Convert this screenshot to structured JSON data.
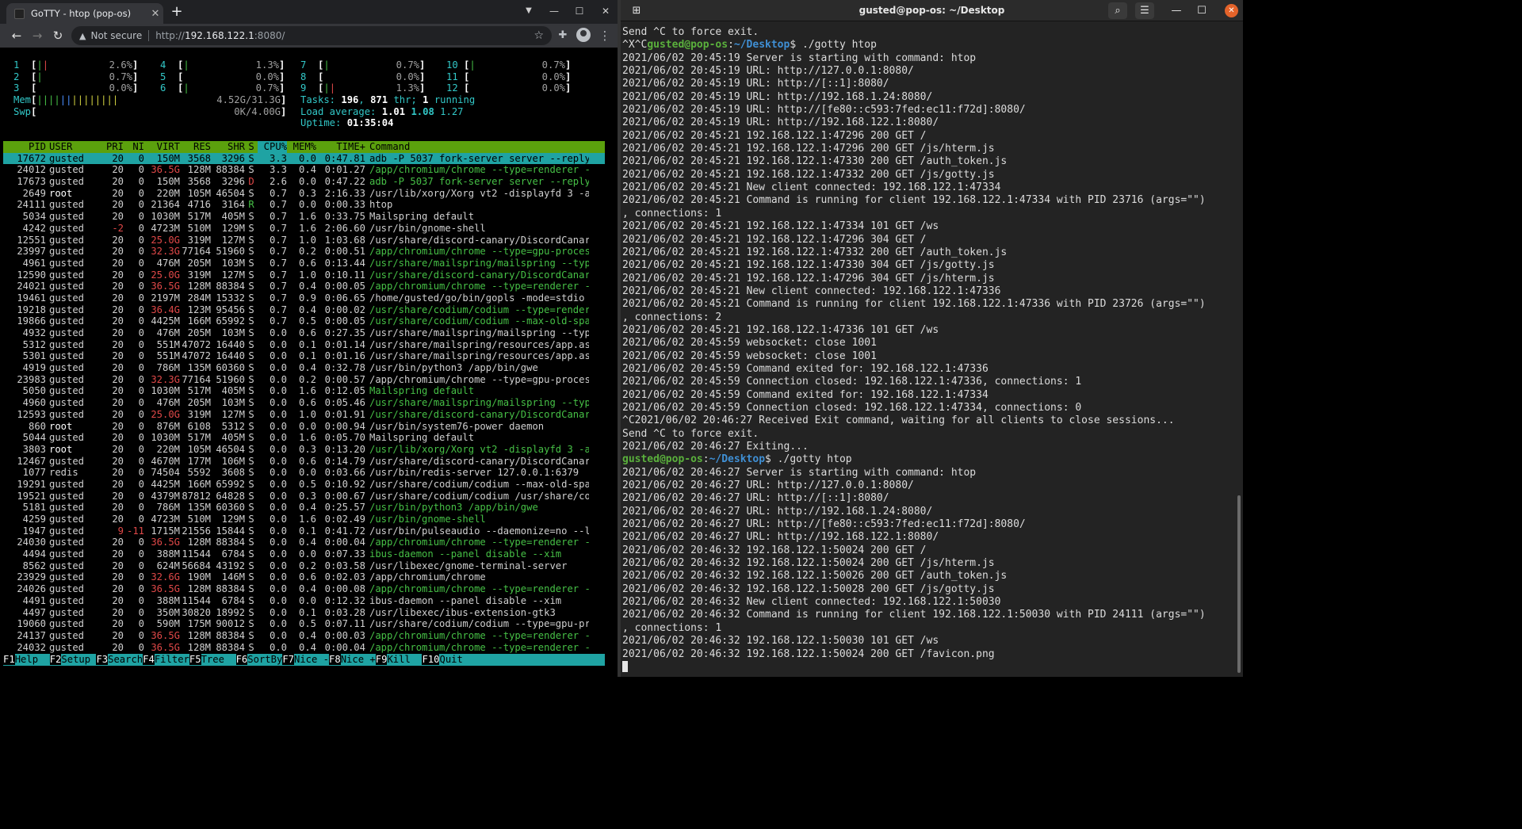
{
  "browser": {
    "tab_title": "GoTTY - htop (pop-os)",
    "tab_close": "✕",
    "new_tab": "+",
    "not_secure": "Not secure",
    "url_proto": "http://",
    "url_host": "192.168.122.1",
    "url_path": ":8080/"
  },
  "htop": {
    "cpu_meters": [
      {
        "num": "1",
        "bar": "||",
        "val": "2.6%"
      },
      {
        "num": "2",
        "bar": "|",
        "val": "0.7%"
      },
      {
        "num": "3",
        "bar": "",
        "val": "0.0%"
      },
      {
        "num": "4",
        "bar": "|",
        "val": "1.3%"
      },
      {
        "num": "5",
        "bar": "",
        "val": "0.0%"
      },
      {
        "num": "6",
        "bar": "|",
        "val": "0.7%"
      },
      {
        "num": "7",
        "bar": "|",
        "val": "0.7%"
      },
      {
        "num": "8",
        "bar": "",
        "val": "0.0%"
      },
      {
        "num": "9",
        "bar": "||",
        "val": "1.3%"
      },
      {
        "num": "10",
        "bar": "|",
        "val": "0.7%"
      },
      {
        "num": "11",
        "bar": "",
        "val": "0.0%"
      },
      {
        "num": "12",
        "bar": "",
        "val": "0.0%"
      }
    ],
    "mem": {
      "label": "Mem",
      "bar": "||||||||||||||",
      "val": "4.52G/31.3G"
    },
    "swp": {
      "label": "Swp",
      "bar": "",
      "val": "0K/4.00G"
    },
    "tasks": {
      "label": "Tasks:",
      "count": "196",
      "thr": "871",
      "thr_label": "thr;",
      "running": "1",
      "running_label": "running"
    },
    "load": {
      "label": "Load average:",
      "v1": "1.01",
      "v2": "1.08",
      "v3": "1.27"
    },
    "uptime": {
      "label": "Uptime:",
      "val": "01:35:04"
    },
    "columns": [
      "PID",
      "USER",
      "PRI",
      "NI",
      "VIRT",
      "RES",
      "SHR",
      "S",
      "CPU%",
      "MEM%",
      "TIME+",
      "Command"
    ],
    "processes": [
      [
        "17672",
        "gusted",
        "20",
        "0",
        "150M",
        "3568",
        "3296",
        "S",
        "3.3",
        "0.0",
        "0:47.81",
        "adb -P 5037 fork-server server --reply"
      ],
      [
        "24012",
        "gusted",
        "20",
        "0",
        "36.5G",
        "128M",
        "88384",
        "S",
        "3.3",
        "0.4",
        "0:01.27",
        "/app/chromium/chrome --type=renderer -"
      ],
      [
        "17673",
        "gusted",
        "20",
        "0",
        "150M",
        "3568",
        "3296",
        "D",
        "2.6",
        "0.0",
        "0:47.22",
        "adb -P 5037 fork-server server --reply"
      ],
      [
        "2649",
        "root",
        "20",
        "0",
        "220M",
        "105M",
        "46504",
        "S",
        "0.7",
        "0.3",
        "2:16.33",
        "/usr/lib/xorg/Xorg vt2 -displayfd 3 -a"
      ],
      [
        "24111",
        "gusted",
        "20",
        "0",
        "21364",
        "4716",
        "3164",
        "R",
        "0.7",
        "0.0",
        "0:00.33",
        "htop"
      ],
      [
        "5034",
        "gusted",
        "20",
        "0",
        "1030M",
        "517M",
        "405M",
        "S",
        "0.7",
        "1.6",
        "0:33.75",
        "Mailspring default"
      ],
      [
        "4242",
        "gusted",
        "-2",
        "0",
        "4723M",
        "510M",
        "129M",
        "S",
        "0.7",
        "1.6",
        "2:06.60",
        "/usr/bin/gnome-shell"
      ],
      [
        "12551",
        "gusted",
        "20",
        "0",
        "25.0G",
        "319M",
        "127M",
        "S",
        "0.7",
        "1.0",
        "1:03.68",
        "/usr/share/discord-canary/DiscordCanar"
      ],
      [
        "23997",
        "gusted",
        "20",
        "0",
        "32.3G",
        "77164",
        "51960",
        "S",
        "0.7",
        "0.2",
        "0:00.51",
        "/app/chromium/chrome --type=gpu-proces"
      ],
      [
        "4961",
        "gusted",
        "20",
        "0",
        "476M",
        "205M",
        "103M",
        "S",
        "0.7",
        "0.6",
        "0:13.44",
        "/usr/share/mailspring/mailspring --typ"
      ],
      [
        "12590",
        "gusted",
        "20",
        "0",
        "25.0G",
        "319M",
        "127M",
        "S",
        "0.7",
        "1.0",
        "0:10.11",
        "/usr/share/discord-canary/DiscordCanar"
      ],
      [
        "24021",
        "gusted",
        "20",
        "0",
        "36.5G",
        "128M",
        "88384",
        "S",
        "0.7",
        "0.4",
        "0:00.05",
        "/app/chromium/chrome --type=renderer -"
      ],
      [
        "19461",
        "gusted",
        "20",
        "0",
        "2197M",
        "284M",
        "15332",
        "S",
        "0.7",
        "0.9",
        "0:06.65",
        "/home/gusted/go/bin/gopls -mode=stdio"
      ],
      [
        "19218",
        "gusted",
        "20",
        "0",
        "36.4G",
        "123M",
        "95456",
        "S",
        "0.7",
        "0.4",
        "0:00.02",
        "/usr/share/codium/codium --type=render"
      ],
      [
        "19866",
        "gusted",
        "20",
        "0",
        "4425M",
        "166M",
        "65992",
        "S",
        "0.7",
        "0.5",
        "0:00.05",
        "/usr/share/codium/codium --max-old-spa"
      ],
      [
        "4932",
        "gusted",
        "20",
        "0",
        "476M",
        "205M",
        "103M",
        "S",
        "0.0",
        "0.6",
        "0:27.35",
        "/usr/share/mailspring/mailspring --typ"
      ],
      [
        "5312",
        "gusted",
        "20",
        "0",
        "551M",
        "47072",
        "16440",
        "S",
        "0.0",
        "0.1",
        "0:01.14",
        "/usr/share/mailspring/resources/app.as"
      ],
      [
        "5301",
        "gusted",
        "20",
        "0",
        "551M",
        "47072",
        "16440",
        "S",
        "0.0",
        "0.1",
        "0:01.16",
        "/usr/share/mailspring/resources/app.as"
      ],
      [
        "4919",
        "gusted",
        "20",
        "0",
        "786M",
        "135M",
        "60360",
        "S",
        "0.0",
        "0.4",
        "0:32.78",
        "/usr/bin/python3 /app/bin/gwe"
      ],
      [
        "23983",
        "gusted",
        "20",
        "0",
        "32.3G",
        "77164",
        "51960",
        "S",
        "0.0",
        "0.2",
        "0:00.57",
        "/app/chromium/chrome --type=gpu-proces"
      ],
      [
        "5050",
        "gusted",
        "20",
        "0",
        "1030M",
        "517M",
        "405M",
        "S",
        "0.0",
        "1.6",
        "0:12.05",
        "Mailspring default"
      ],
      [
        "4960",
        "gusted",
        "20",
        "0",
        "476M",
        "205M",
        "103M",
        "S",
        "0.0",
        "0.6",
        "0:05.46",
        "/usr/share/mailspring/mailspring --typ"
      ],
      [
        "12593",
        "gusted",
        "20",
        "0",
        "25.0G",
        "319M",
        "127M",
        "S",
        "0.0",
        "1.0",
        "0:01.91",
        "/usr/share/discord-canary/DiscordCanar"
      ],
      [
        "860",
        "root",
        "20",
        "0",
        "876M",
        "6108",
        "5312",
        "S",
        "0.0",
        "0.0",
        "0:00.94",
        "/usr/bin/system76-power daemon"
      ],
      [
        "5044",
        "gusted",
        "20",
        "0",
        "1030M",
        "517M",
        "405M",
        "S",
        "0.0",
        "1.6",
        "0:05.70",
        "Mailspring default"
      ],
      [
        "3803",
        "root",
        "20",
        "0",
        "220M",
        "105M",
        "46504",
        "S",
        "0.0",
        "0.3",
        "0:13.20",
        "/usr/lib/xorg/Xorg vt2 -displayfd 3 -a"
      ],
      [
        "12467",
        "gusted",
        "20",
        "0",
        "4670M",
        "177M",
        "106M",
        "S",
        "0.0",
        "0.6",
        "0:14.79",
        "/usr/share/discord-canary/DiscordCanar"
      ],
      [
        "1077",
        "redis",
        "20",
        "0",
        "74504",
        "5592",
        "3608",
        "S",
        "0.0",
        "0.0",
        "0:03.66",
        "/usr/bin/redis-server 127.0.0.1:6379"
      ],
      [
        "19291",
        "gusted",
        "20",
        "0",
        "4425M",
        "166M",
        "65992",
        "S",
        "0.0",
        "0.5",
        "0:10.92",
        "/usr/share/codium/codium --max-old-spa"
      ],
      [
        "19521",
        "gusted",
        "20",
        "0",
        "4379M",
        "87812",
        "64828",
        "S",
        "0.0",
        "0.3",
        "0:00.67",
        "/usr/share/codium/codium /usr/share/co"
      ],
      [
        "5181",
        "gusted",
        "20",
        "0",
        "786M",
        "135M",
        "60360",
        "S",
        "0.0",
        "0.4",
        "0:25.57",
        "/usr/bin/python3 /app/bin/gwe"
      ],
      [
        "4259",
        "gusted",
        "20",
        "0",
        "4723M",
        "510M",
        "129M",
        "S",
        "0.0",
        "1.6",
        "0:02.49",
        "/usr/bin/gnome-shell"
      ],
      [
        "1947",
        "gusted",
        "9",
        "-11",
        "1715M",
        "21556",
        "15844",
        "S",
        "0.0",
        "0.1",
        "0:41.72",
        "/usr/bin/pulseaudio --daemonize=no --l"
      ],
      [
        "24030",
        "gusted",
        "20",
        "0",
        "36.5G",
        "128M",
        "88384",
        "S",
        "0.0",
        "0.4",
        "0:00.04",
        "/app/chromium/chrome --type=renderer -"
      ],
      [
        "4494",
        "gusted",
        "20",
        "0",
        "388M",
        "11544",
        "6784",
        "S",
        "0.0",
        "0.0",
        "0:07.33",
        "ibus-daemon --panel disable --xim"
      ],
      [
        "8562",
        "gusted",
        "20",
        "0",
        "624M",
        "56684",
        "43192",
        "S",
        "0.0",
        "0.2",
        "0:03.58",
        "/usr/libexec/gnome-terminal-server"
      ],
      [
        "23929",
        "gusted",
        "20",
        "0",
        "32.6G",
        "190M",
        "146M",
        "S",
        "0.0",
        "0.6",
        "0:02.03",
        "/app/chromium/chrome"
      ],
      [
        "24026",
        "gusted",
        "20",
        "0",
        "36.5G",
        "128M",
        "88384",
        "S",
        "0.0",
        "0.4",
        "0:00.08",
        "/app/chromium/chrome --type=renderer -"
      ],
      [
        "4491",
        "gusted",
        "20",
        "0",
        "388M",
        "11544",
        "6784",
        "S",
        "0.0",
        "0.0",
        "0:12.32",
        "ibus-daemon --panel disable --xim"
      ],
      [
        "4497",
        "gusted",
        "20",
        "0",
        "350M",
        "30820",
        "18992",
        "S",
        "0.0",
        "0.1",
        "0:03.28",
        "/usr/libexec/ibus-extension-gtk3"
      ],
      [
        "19060",
        "gusted",
        "20",
        "0",
        "590M",
        "175M",
        "90012",
        "S",
        "0.0",
        "0.5",
        "0:07.11",
        "/usr/share/codium/codium --type=gpu-pr"
      ],
      [
        "24137",
        "gusted",
        "20",
        "0",
        "36.5G",
        "128M",
        "88384",
        "S",
        "0.0",
        "0.4",
        "0:00.03",
        "/app/chromium/chrome --type=renderer -"
      ],
      [
        "24032",
        "gusted",
        "20",
        "0",
        "36.5G",
        "128M",
        "88384",
        "S",
        "0.0",
        "0.4",
        "0:00.04",
        "/app/chromium/chrome --type=renderer -"
      ]
    ],
    "green_rows": [
      1,
      2,
      8,
      9,
      10,
      11,
      13,
      14,
      20,
      21,
      22,
      25,
      30,
      31,
      33,
      34,
      37,
      41,
      42
    ],
    "fkeys": [
      {
        "k": "F1",
        "l": "Help  "
      },
      {
        "k": "F2",
        "l": "Setup "
      },
      {
        "k": "F3",
        "l": "Search"
      },
      {
        "k": "F4",
        "l": "Filter"
      },
      {
        "k": "F5",
        "l": "Tree  "
      },
      {
        "k": "F6",
        "l": "SortBy"
      },
      {
        "k": "F7",
        "l": "Nice -"
      },
      {
        "k": "F8",
        "l": "Nice +"
      },
      {
        "k": "F9",
        "l": "Kill  "
      },
      {
        "k": "F10",
        "l": "Quit"
      }
    ]
  },
  "terminal": {
    "title": "gusted@pop-os: ~/Desktop",
    "prompt_user": "gusted@pop-os",
    "prompt_path": "~/Desktop",
    "lines": [
      {
        "t": "Send ^C to force exit."
      },
      {
        "pre": "^X^C",
        "prompt": true,
        "cmd": "$ ./gotty htop"
      },
      {
        "t": "2021/06/02 20:45:19 Server is starting with command: htop"
      },
      {
        "t": "2021/06/02 20:45:19 URL: http://127.0.0.1:8080/"
      },
      {
        "t": "2021/06/02 20:45:19 URL: http://[::1]:8080/"
      },
      {
        "t": "2021/06/02 20:45:19 URL: http://192.168.1.24:8080/"
      },
      {
        "t": "2021/06/02 20:45:19 URL: http://[fe80::c593:7fed:ec11:f72d]:8080/"
      },
      {
        "t": "2021/06/02 20:45:19 URL: http://192.168.122.1:8080/"
      },
      {
        "t": "2021/06/02 20:45:21 192.168.122.1:47296 200 GET /"
      },
      {
        "t": "2021/06/02 20:45:21 192.168.122.1:47296 200 GET /js/hterm.js"
      },
      {
        "t": "2021/06/02 20:45:21 192.168.122.1:47330 200 GET /auth_token.js"
      },
      {
        "t": "2021/06/02 20:45:21 192.168.122.1:47332 200 GET /js/gotty.js"
      },
      {
        "t": "2021/06/02 20:45:21 New client connected: 192.168.122.1:47334"
      },
      {
        "t": "2021/06/02 20:45:21 Command is running for client 192.168.122.1:47334 with PID 23716 (args=\"\")"
      },
      {
        "t": ", connections: 1"
      },
      {
        "t": "2021/06/02 20:45:21 192.168.122.1:47334 101 GET /ws"
      },
      {
        "t": "2021/06/02 20:45:21 192.168.122.1:47296 304 GET /"
      },
      {
        "t": "2021/06/02 20:45:21 192.168.122.1:47332 200 GET /auth_token.js"
      },
      {
        "t": "2021/06/02 20:45:21 192.168.122.1:47330 304 GET /js/gotty.js"
      },
      {
        "t": "2021/06/02 20:45:21 192.168.122.1:47296 304 GET /js/hterm.js"
      },
      {
        "t": "2021/06/02 20:45:21 New client connected: 192.168.122.1:47336"
      },
      {
        "t": "2021/06/02 20:45:21 Command is running for client 192.168.122.1:47336 with PID 23726 (args=\"\")"
      },
      {
        "t": ", connections: 2"
      },
      {
        "t": "2021/06/02 20:45:21 192.168.122.1:47336 101 GET /ws"
      },
      {
        "t": "2021/06/02 20:45:59 websocket: close 1001"
      },
      {
        "t": "2021/06/02 20:45:59 websocket: close 1001"
      },
      {
        "t": "2021/06/02 20:45:59 Command exited for: 192.168.122.1:47336"
      },
      {
        "t": "2021/06/02 20:45:59 Connection closed: 192.168.122.1:47336, connections: 1"
      },
      {
        "t": "2021/06/02 20:45:59 Command exited for: 192.168.122.1:47334"
      },
      {
        "t": "2021/06/02 20:45:59 Connection closed: 192.168.122.1:47334, connections: 0"
      },
      {
        "t": "^C2021/06/02 20:46:27 Received Exit command, waiting for all clients to close sessions..."
      },
      {
        "t": "Send ^C to force exit."
      },
      {
        "t": "2021/06/02 20:46:27 Exiting..."
      },
      {
        "pre": "",
        "prompt": true,
        "cmd": "$ ./gotty htop"
      },
      {
        "t": "2021/06/02 20:46:27 Server is starting with command: htop"
      },
      {
        "t": "2021/06/02 20:46:27 URL: http://127.0.0.1:8080/"
      },
      {
        "t": "2021/06/02 20:46:27 URL: http://[::1]:8080/"
      },
      {
        "t": "2021/06/02 20:46:27 URL: http://192.168.1.24:8080/"
      },
      {
        "t": "2021/06/02 20:46:27 URL: http://[fe80::c593:7fed:ec11:f72d]:8080/"
      },
      {
        "t": "2021/06/02 20:46:27 URL: http://192.168.122.1:8080/"
      },
      {
        "t": "2021/06/02 20:46:32 192.168.122.1:50024 200 GET /"
      },
      {
        "t": "2021/06/02 20:46:32 192.168.122.1:50024 200 GET /js/hterm.js"
      },
      {
        "t": "2021/06/02 20:46:32 192.168.122.1:50026 200 GET /auth_token.js"
      },
      {
        "t": "2021/06/02 20:46:32 192.168.122.1:50028 200 GET /js/gotty.js"
      },
      {
        "t": "2021/06/02 20:46:32 New client connected: 192.168.122.1:50030"
      },
      {
        "t": "2021/06/02 20:46:32 Command is running for client 192.168.122.1:50030 with PID 24111 (args=\"\")"
      },
      {
        "t": ", connections: 1"
      },
      {
        "t": "2021/06/02 20:46:32 192.168.122.1:50030 101 GET /ws"
      },
      {
        "t": "2021/06/02 20:46:32 192.168.122.1:50024 200 GET /favicon.png"
      }
    ]
  },
  "colors": {
    "htop_header_bg": "#5ba10d",
    "htop_selected_bg": "#1fa3a3",
    "prompt_user": "#5ab03c",
    "prompt_path": "#3f8fd4",
    "close_button": "#e4632a"
  }
}
